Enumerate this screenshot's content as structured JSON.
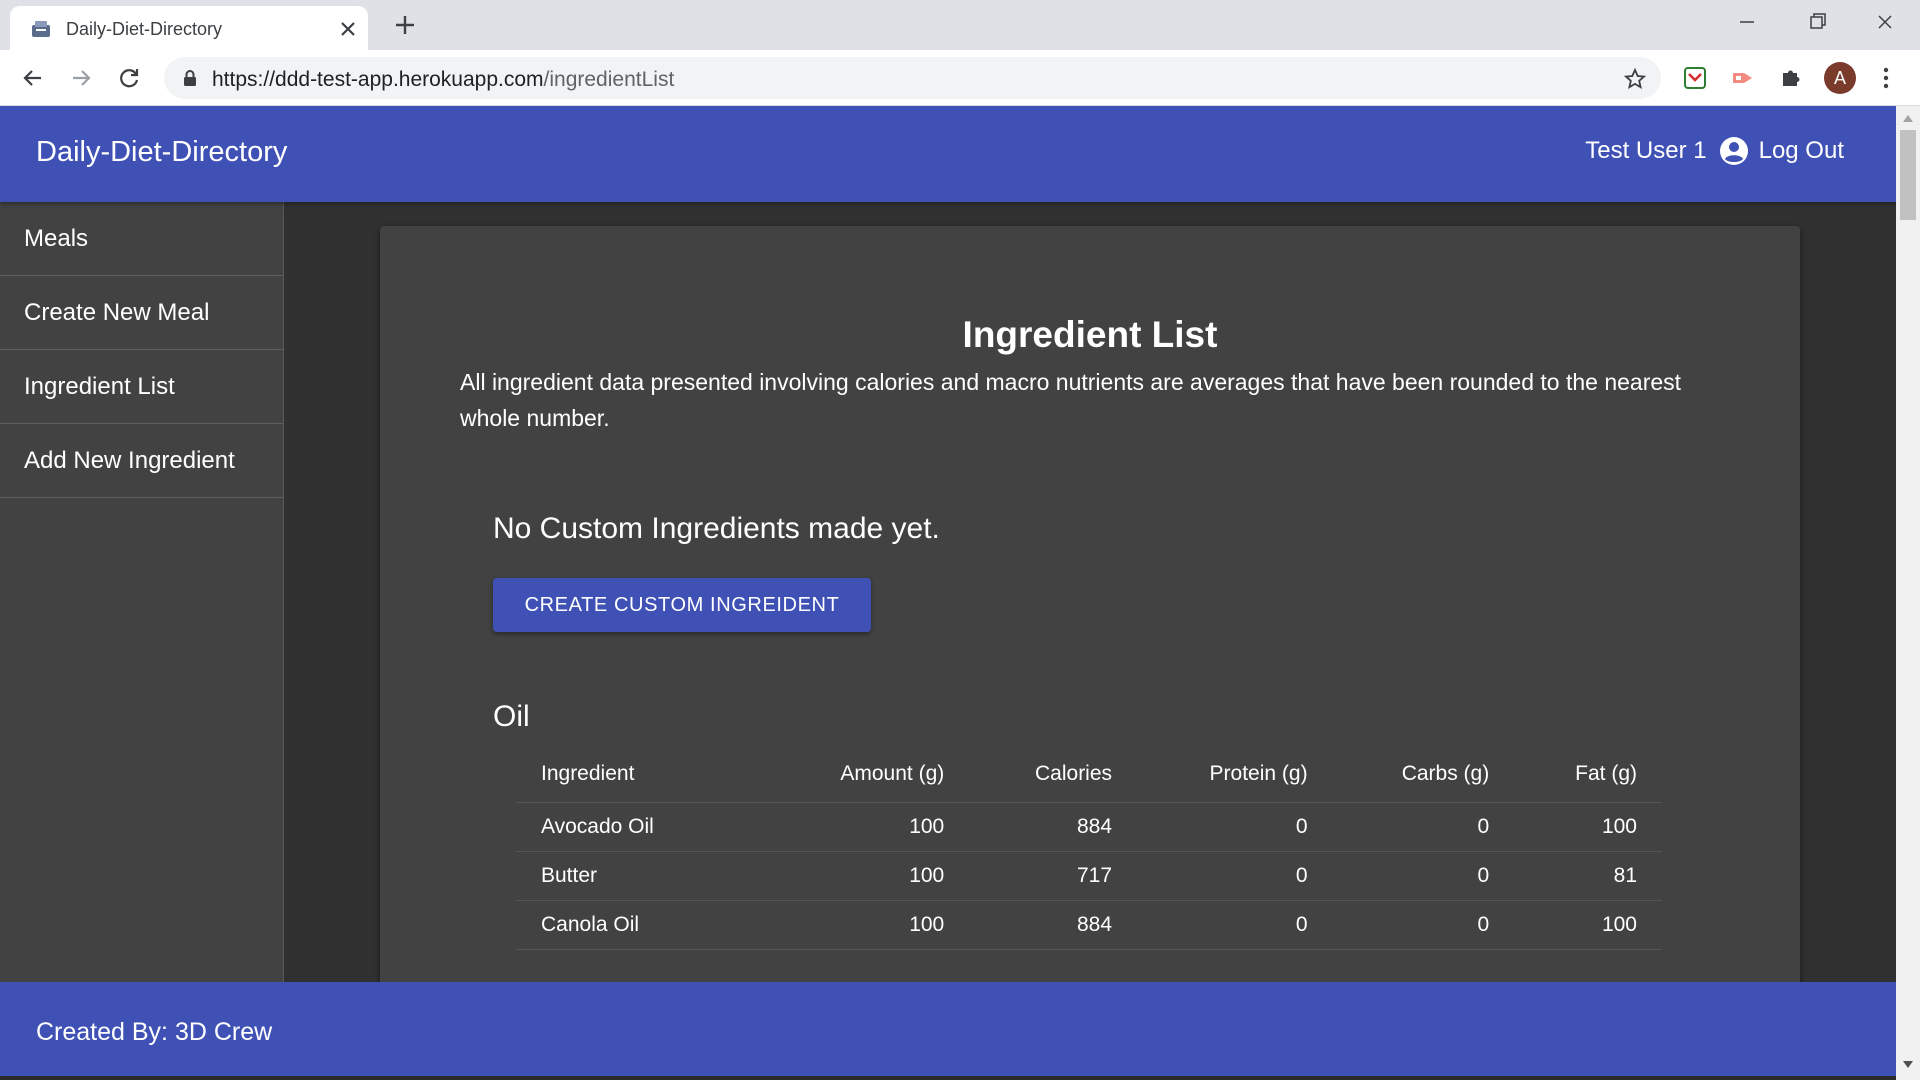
{
  "browser": {
    "tab_title": "Daily-Diet-Directory",
    "url_host": "https://ddd-test-app.herokuapp.com",
    "url_path": "/ingredientList",
    "avatar_letter": "A"
  },
  "header": {
    "app_title": "Daily-Diet-Directory",
    "user_name": "Test User 1",
    "logout_label": "Log Out"
  },
  "sidebar": {
    "items": [
      {
        "label": "Meals"
      },
      {
        "label": "Create New Meal"
      },
      {
        "label": "Ingredient List"
      },
      {
        "label": "Add New Ingredient"
      }
    ]
  },
  "main": {
    "title": "Ingredient List",
    "description": "All ingredient data presented involving calories and macro nutrients are averages that have been rounded to the nearest whole number.",
    "no_custom_text": "No Custom Ingredients made yet.",
    "create_button_label": "CREATE CUSTOM INGREIDENT",
    "section_title": "Oil",
    "table": {
      "headers": [
        "Ingredient",
        "Amount (g)",
        "Calories",
        "Protein (g)",
        "Carbs (g)",
        "Fat (g)"
      ],
      "rows": [
        [
          "Avocado Oil",
          "100",
          "884",
          "0",
          "0",
          "100"
        ],
        [
          "Butter",
          "100",
          "717",
          "0",
          "0",
          "81"
        ],
        [
          "Canola Oil",
          "100",
          "884",
          "0",
          "0",
          "100"
        ]
      ]
    }
  },
  "footer": {
    "text": "Created By: 3D Crew"
  },
  "colors": {
    "primary": "#3f51b5",
    "background": "#303030",
    "card": "#424242"
  }
}
